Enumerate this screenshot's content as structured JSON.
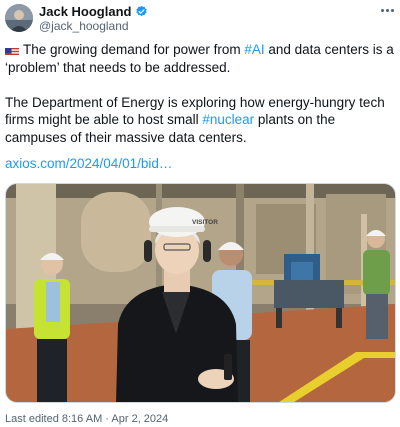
{
  "author": {
    "name": "Jack Hoogland",
    "handle": "@jack_hoogland",
    "verified": true,
    "avatar_icon": "avatar-photo"
  },
  "tweet": {
    "flag_icon": "us-flag-icon",
    "line1_before": "The growing demand for power from ",
    "hashtag_ai": "#AI",
    "line1_after": " and data centers is a ‘problem’ that needs to be addressed.",
    "line2_before": "The Department of Energy is exploring how energy-hungry tech firms might be able to host small ",
    "hashtag_nuclear": "#nuclear",
    "line2_after": " plants on the campuses of their massive data centers.",
    "link": "axios.com/2024/04/01/bid…"
  },
  "photo": {
    "hard_hat_text": "VISITOR"
  },
  "footer": {
    "edited_label": "Last edited 8:16 AM · Apr 2, 2024"
  },
  "colors": {
    "link": "#1d9bf0",
    "verified": "#1d9bf0",
    "secondary_text": "#536471"
  }
}
